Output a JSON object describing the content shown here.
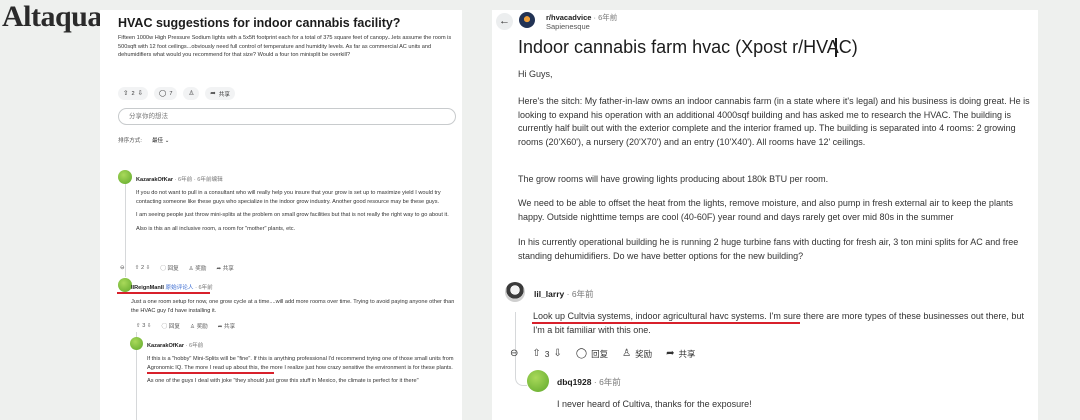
{
  "brand": "Altaqua",
  "left_post": {
    "title": "HVAC suggestions for indoor cannabis facility?",
    "body": "Fifteen 1000w High Pressure Sodium lights with a 5x5ft footprint each for a total of 375 square feet of canopy...lets assume the room is 500sqft with 12 foot ceilings...obviously need full control of temperature and humidity levels. As far as commercial AC units and dehumidifiers what would you recommend for that size? Would a four ton minisplit be overkill?",
    "votes": "2",
    "comments": "7",
    "share": "共享",
    "input_placeholder": "分享你的想法",
    "sort_label": "排序方式:",
    "sort_value": "最佳",
    "comments_list": [
      {
        "user": "KazarakOfKar",
        "meta": "· 6年前 · 6年前编辑",
        "paragraphs": [
          "If you do not want to pull in a consultant who will really help you insure that your grow is set up to maximize yield I would try contacting someone like these guys who specialize in the indoor grow industry. Another good resource may be these guys.",
          "I am seeing people just throw mini-splits at the problem on small grow facilities but that is not really the right way to go about it.",
          "Also is this an all inclusive room, a room for \"mother\" plants, etc."
        ],
        "votes": "2",
        "reply": "回复",
        "award": "奖励",
        "share": "共享"
      },
      {
        "user": "IIReignManII",
        "flair": "原始评论人",
        "meta": "· 6年前",
        "paragraphs": [
          "Just a one room setup for now, one grow cycle at a time....will add more rooms over time. Trying to avoid paying anyone other than the HVAC guy I'd have installing it."
        ],
        "votes": "3",
        "reply": "回复",
        "award": "奖励",
        "share": "共享"
      },
      {
        "user": "KazarakOfKar",
        "meta": "· 6年前",
        "paragraphs": [
          "If this is a \"hobby\" Mini-Splits will be \"fine\". If this is anything professional I'd recommend trying one of those small units from Agronomic IQ. The more I read up about this, the more I realize just how crazy sensitive the environment is for these plants.",
          "As one of the guys I deal with joke \"they should just grow this stuff in Mexico, the climate is perfect for it there\""
        ]
      }
    ]
  },
  "right_post": {
    "subreddit": "r/hvacadvice",
    "time": "· 6年前",
    "author": "Sapienesque",
    "title": "Indoor cannabis farm hvac (Xpost r/HVAC)",
    "paragraphs": [
      "Hi Guys,",
      "Here's the sitch: My father-in-law owns an indoor cannabis farm (in a state where it's legal) and his business is doing great. He is looking to expand his operation with an additional 4000sqf building and has asked me to research the HVAC. The building is currently half built out with the exterior complete and the interior framed up. The building is separated into 4 rooms: 2 growing rooms (20'X60'), a nursery (20'X70') and an entry (10'X40'). All rooms have 12' ceilings.",
      "The grow rooms will have growing lights producing about 180k BTU per room.",
      "We need to be able to offset the heat from the lights, remove moisture, and also pump in fresh external air to keep the plants happy. Outside nighttime temps are cool (40-60F) year round and days rarely get over mid 80s in the summer",
      "In his currently operational building he is running 2 huge turbine fans with ducting for fresh air, 3 ton mini splits for AC and free standing dehumidifiers. Do we have better options for the new building?"
    ],
    "comment1": {
      "user": "lil_larry",
      "meta": "· 6年前",
      "text": "Look up Cultvia systems, indoor agricultural havc systems. I'm sure there are more types of these businesses out there, but I'm a bit familiar with this one.",
      "votes": "3",
      "reply": "回复",
      "award": "奖励",
      "share": "共享"
    },
    "comment2": {
      "user": "dbq1928",
      "meta": "· 6年前",
      "text": "I never heard of Cultiva, thanks for the exposure!"
    }
  }
}
